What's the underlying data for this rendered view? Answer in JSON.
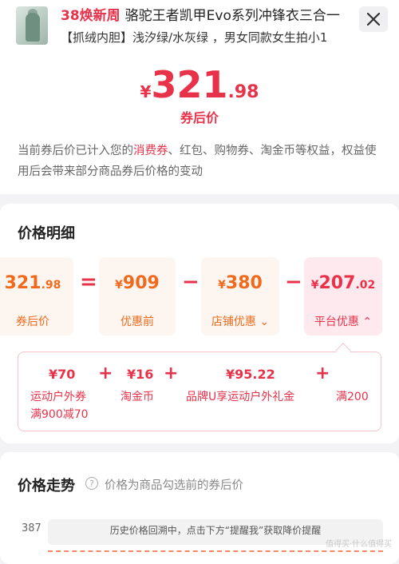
{
  "header": {
    "promo_tag": "38焕新周",
    "title": "骆驼王者凯甲Evo系列冲锋衣三合一",
    "subtitle": "【抓绒内胆】浅汐绿/水灰绿 ，男女同款女生拍小1"
  },
  "price": {
    "currency": "¥",
    "integer": "321",
    "decimal": ".98",
    "label": "券后价"
  },
  "description": {
    "part1": "当前券后价已计入您的",
    "highlight": "消费券",
    "part2": "、红包、购物券、淘金币等权益，权益使用后会带来部分商品券后价格的变动"
  },
  "detail": {
    "title": "价格明细",
    "boxes": [
      {
        "value_int": "321",
        "value_dec": ".98",
        "label": "券后价"
      },
      {
        "value_int": "909",
        "value_dec": "",
        "label": "优惠前"
      },
      {
        "value_int": "380",
        "value_dec": "",
        "label": "店铺优惠 ⌄"
      },
      {
        "value_int": "207",
        "value_dec": ".02",
        "label": "平台优惠 ⌃"
      }
    ],
    "ops": [
      "=",
      "−",
      "−"
    ],
    "platform_items": [
      {
        "value": "¥70",
        "label": "运动户外券",
        "sub": "满900减70"
      },
      {
        "value": "¥16",
        "label": "淘金币",
        "sub": ""
      },
      {
        "value": "¥95.22",
        "label": "品牌U享运动户外礼金",
        "sub": ""
      },
      {
        "value": "",
        "label": "满200",
        "sub": ""
      }
    ],
    "plus": [
      "+",
      "+",
      "+"
    ]
  },
  "trend": {
    "title": "价格走势",
    "note": "价格为商品勾选前的券后价",
    "axis_value": "387",
    "tooltip": "历史价格回溯中，点击下方“提醒我”获取降价提醒"
  },
  "watermark": "值得买·什么值得买",
  "icons": {
    "close": "close-icon",
    "info": "info-icon"
  }
}
